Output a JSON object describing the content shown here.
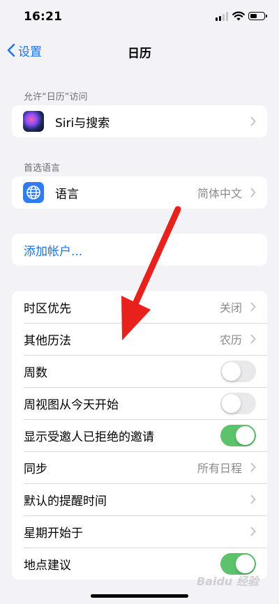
{
  "status": {
    "time": "16:21",
    "battery_level": 0.55
  },
  "nav": {
    "back_label": "设置",
    "title": "日历"
  },
  "sections": {
    "access_header": "允许“日历”访问",
    "siri_label": "Siri与搜索",
    "language_header": "首选语言",
    "language_label": "语言",
    "language_value": "简体中文",
    "add_account": "添加帐户..."
  },
  "settings": [
    {
      "label": "时区优先",
      "value": "关闭",
      "type": "nav"
    },
    {
      "label": "其他历法",
      "value": "农历",
      "type": "nav"
    },
    {
      "label": "周数",
      "type": "toggle",
      "on": false
    },
    {
      "label": "周视图从今天开始",
      "type": "toggle",
      "on": false
    },
    {
      "label": "显示受邀人已拒绝的邀请",
      "type": "toggle",
      "on": true
    },
    {
      "label": "同步",
      "value": "所有日程",
      "type": "nav"
    },
    {
      "label": "默认的提醒时间",
      "value": "",
      "type": "nav"
    },
    {
      "label": "星期开始于",
      "value": "",
      "type": "nav"
    },
    {
      "label": "地点建议",
      "type": "toggle",
      "on": true
    }
  ],
  "watermark": "Baidu 经验",
  "colors": {
    "accent": "#1a73e8",
    "toggle_on": "#5cc26b",
    "arrow": "#e8211c"
  }
}
